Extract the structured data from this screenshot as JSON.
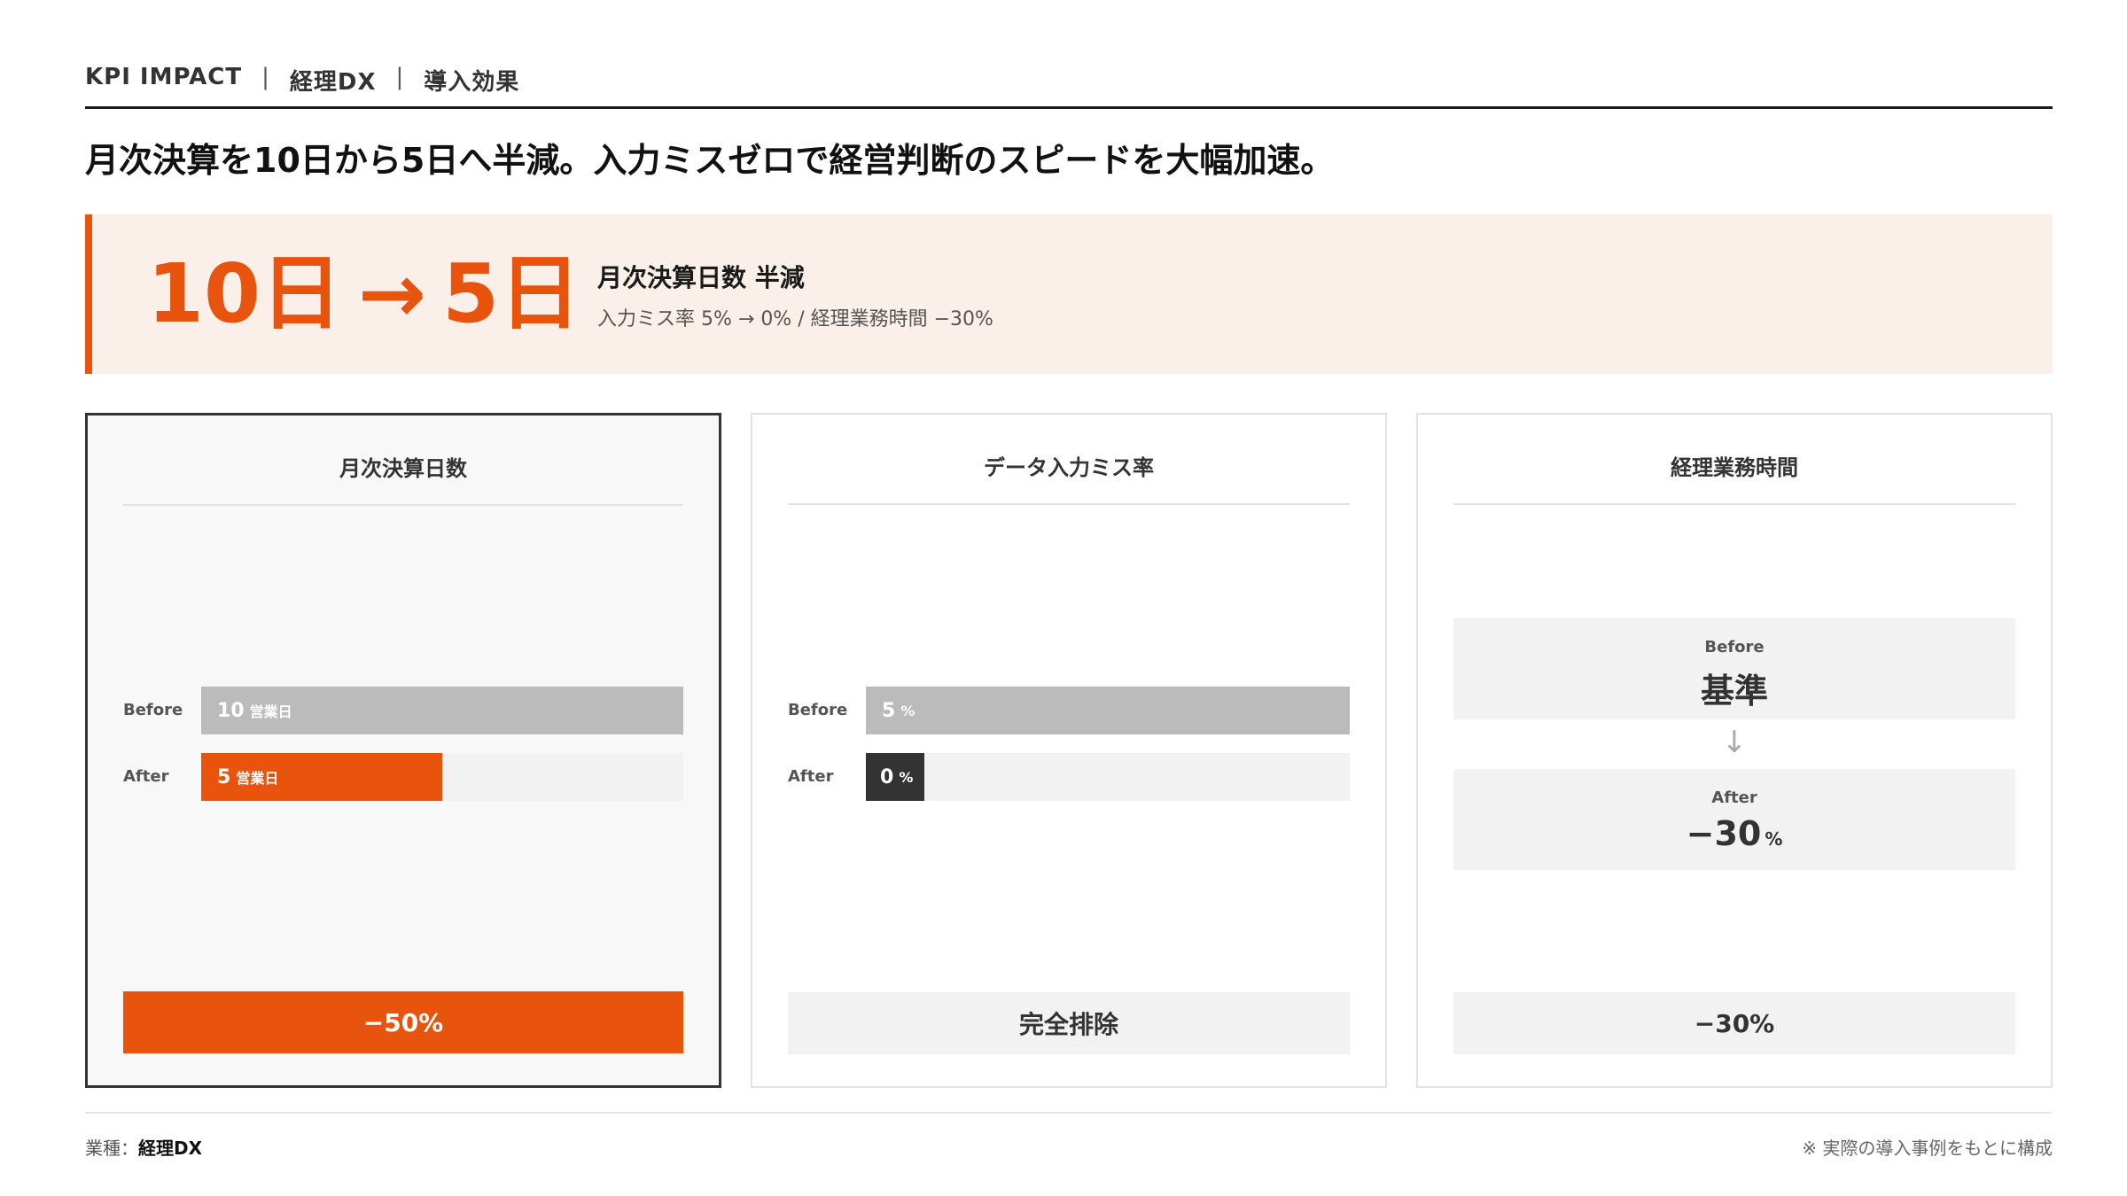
{
  "header": {
    "label": "KPI IMPACT",
    "sep": "|",
    "category": "経理DX",
    "topic": "導入効果"
  },
  "headline": "月次決算を10日から5日へ半減。入力ミスゼロで経営判断のスピードを大幅加速。",
  "hero": {
    "before": "10日",
    "arrow": "→",
    "after": "5日",
    "title": "月次決算日数 半減",
    "subtitle": "入力ミス率 5% → 0% / 経理業務時間 −30%"
  },
  "cards": [
    {
      "title": "月次決算日数",
      "before_label": "Before",
      "before_value": "10",
      "before_unit": "営業日",
      "before_fraction": 1.0,
      "after_label": "After",
      "after_value": "5",
      "after_unit": "営業日",
      "after_fraction": 0.5,
      "footer": "−50%"
    },
    {
      "title": "データ入力ミス率",
      "before_label": "Before",
      "before_value": "5",
      "before_unit": "%",
      "before_fraction": 1.0,
      "after_label": "After",
      "after_value": "0",
      "after_unit": "%",
      "after_fraction": 0.12,
      "footer": "完全排除"
    },
    {
      "title": "経理業務時間",
      "before_label": "Before",
      "before_value": "基準",
      "arrow": "↓",
      "after_label": "After",
      "after_value": "−30",
      "after_unit": "%",
      "footer": "−30%"
    }
  ],
  "footer": {
    "industry_label": "業種：",
    "industry_value": "経理DX",
    "note": "※ 実際の導入事例をもとに構成"
  },
  "colors": {
    "accent": "#e8530e",
    "hero_bg": "#fbefe9",
    "bar_gray": "#bbbbbb",
    "bar_dark": "#333333",
    "box_gray": "#f2f2f2"
  }
}
